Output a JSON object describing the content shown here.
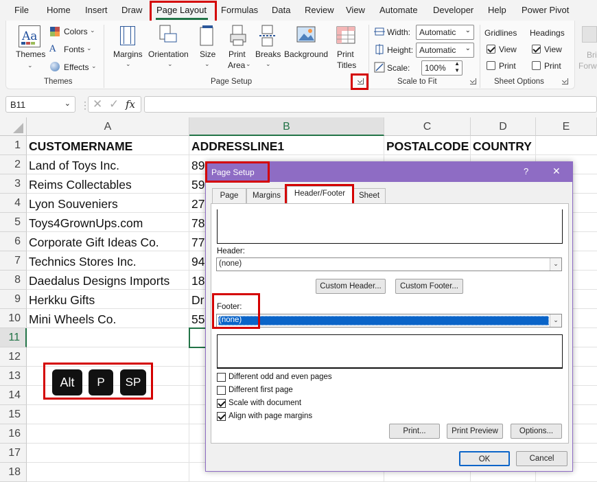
{
  "menu": [
    "File",
    "Home",
    "Insert",
    "Draw",
    "Page Layout",
    "Formulas",
    "Data",
    "Review",
    "View",
    "Automate",
    "Developer",
    "Help",
    "Power Pivot"
  ],
  "ribbon": {
    "themes": {
      "themes": "Themes",
      "colors": "Colors",
      "fonts": "Fonts",
      "effects": "Effects",
      "group": "Themes"
    },
    "page_setup": {
      "margins": "Margins",
      "orientation": "Orientation",
      "size": "Size",
      "print_area_1": "Print",
      "print_area_2": "Area",
      "breaks": "Breaks",
      "background": "Background",
      "print_titles_1": "Print",
      "print_titles_2": "Titles",
      "group": "Page Setup"
    },
    "scale": {
      "width_label": "Width:",
      "width_value": "Automatic",
      "height_label": "Height:",
      "height_value": "Automatic",
      "scale_label": "Scale:",
      "scale_value": "100%",
      "group": "Scale to Fit"
    },
    "sheet_options": {
      "gridlines": "Gridlines",
      "headings": "Headings",
      "view": "View",
      "print": "Print",
      "group": "Sheet Options"
    },
    "arrange": {
      "bring_1": "Bri",
      "bring_2": "Forwa"
    }
  },
  "formula_bar": {
    "name_box": "B11",
    "fx": "fx",
    "value": ""
  },
  "grid": {
    "columns": [
      "A",
      "B",
      "C",
      "D",
      "E"
    ],
    "rows": [
      "1",
      "2",
      "3",
      "4",
      "5",
      "6",
      "7",
      "8",
      "9",
      "10",
      "11",
      "12",
      "13",
      "14",
      "15",
      "16",
      "17",
      "18"
    ],
    "headers": [
      "CUSTOMERNAME",
      "ADDRESSLINE1",
      "POSTALCODE",
      "COUNTRY"
    ],
    "data": [
      [
        "Land of Toys Inc.",
        "89"
      ],
      [
        "Reims Collectables",
        "59"
      ],
      [
        "Lyon Souveniers",
        "27"
      ],
      [
        "Toys4GrownUps.com",
        "78"
      ],
      [
        "Corporate Gift Ideas Co.",
        "77"
      ],
      [
        "Technics Stores Inc.",
        "94"
      ],
      [
        "Daedalus Designs Imports",
        "18"
      ],
      [
        "Herkku Gifts",
        "Dr"
      ],
      [
        "Mini Wheels Co.",
        "55"
      ]
    ]
  },
  "keys": [
    "Alt",
    "P",
    "SP"
  ],
  "dialog": {
    "title": "Page Setup",
    "help": "?",
    "close": "✕",
    "tabs": [
      "Page",
      "Margins",
      "Header/Footer",
      "Sheet"
    ],
    "header_label": "Header:",
    "header_value": "(none)",
    "custom_header": "Custom Header...",
    "custom_footer": "Custom Footer...",
    "footer_label": "Footer:",
    "footer_value": "(none)",
    "options": [
      {
        "label": "Different odd and even pages",
        "checked": false
      },
      {
        "label": "Different first page",
        "checked": false
      },
      {
        "label": "Scale with document",
        "checked": true
      },
      {
        "label": "Align with page margins",
        "checked": true
      }
    ],
    "print": "Print...",
    "print_preview": "Print Preview",
    "options_btn": "Options...",
    "ok": "OK",
    "cancel": "Cancel"
  },
  "colors": {
    "excel_green": "#217346",
    "dialog_purple": "#8e6cc4",
    "highlight": "#d40000",
    "selection_blue": "#0a64c8"
  }
}
